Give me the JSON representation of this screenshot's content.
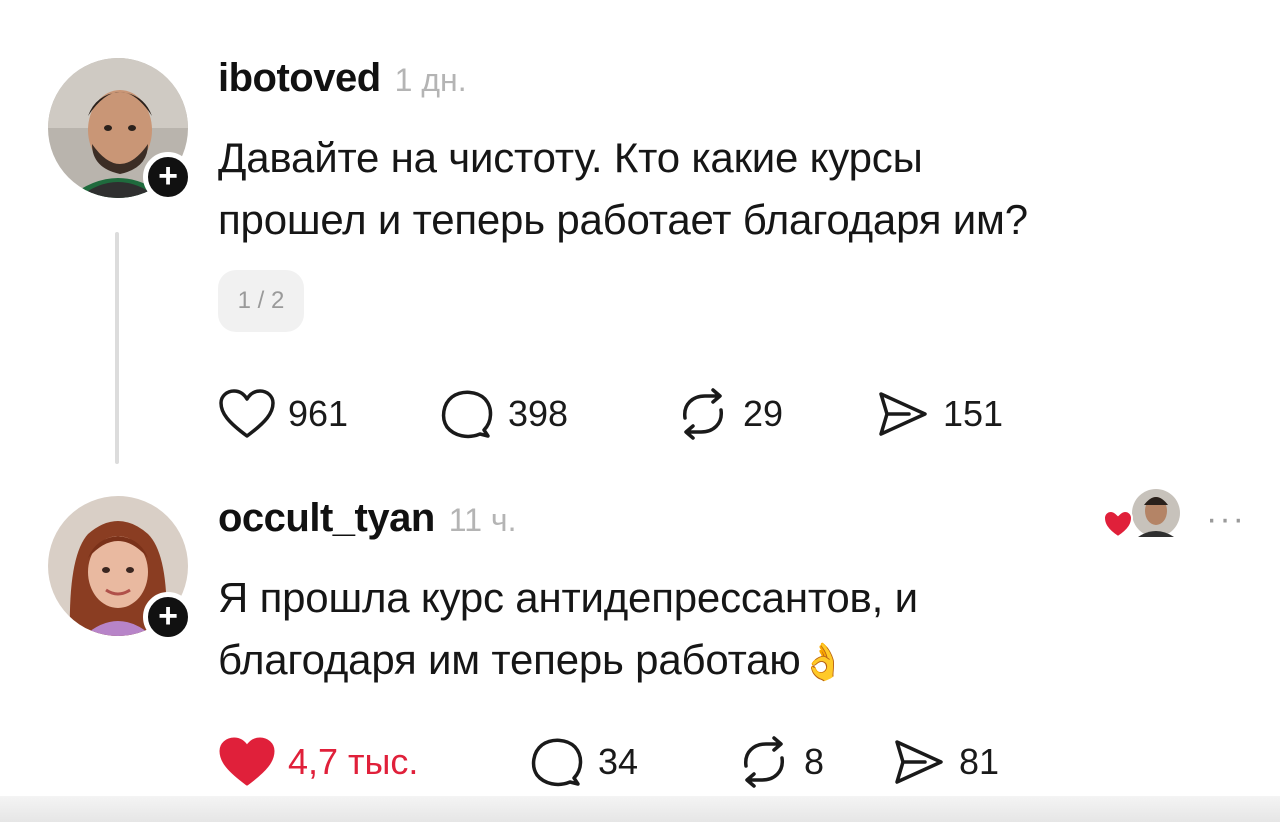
{
  "posts": [
    {
      "username": "ibotoved",
      "time": "1 дн.",
      "text_line1": "Давайте на чистоту. Кто какие курсы",
      "text_line2": "прошел и теперь работает благодаря им?",
      "page_indicator": "1 / 2",
      "likes": "961",
      "replies": "398",
      "reposts": "29",
      "shares": "151"
    },
    {
      "username": "occult_tyan",
      "time": "11 ч.",
      "text_line1": "Я прошла курс антидепрессантов, и",
      "text_line2": "благодаря им теперь работаю",
      "emoji": "👌",
      "likes": "4,7 тыс.",
      "replies": "34",
      "reposts": "8",
      "shares": "81"
    }
  ],
  "follow_symbol": "+",
  "more_symbol": "···",
  "colors": {
    "like_active": "#e0203a",
    "muted": "#b4b4b4",
    "text": "#161616"
  },
  "icons": [
    "heart-icon",
    "reply-icon",
    "repost-icon",
    "share-icon",
    "plus-icon",
    "more-icon"
  ]
}
